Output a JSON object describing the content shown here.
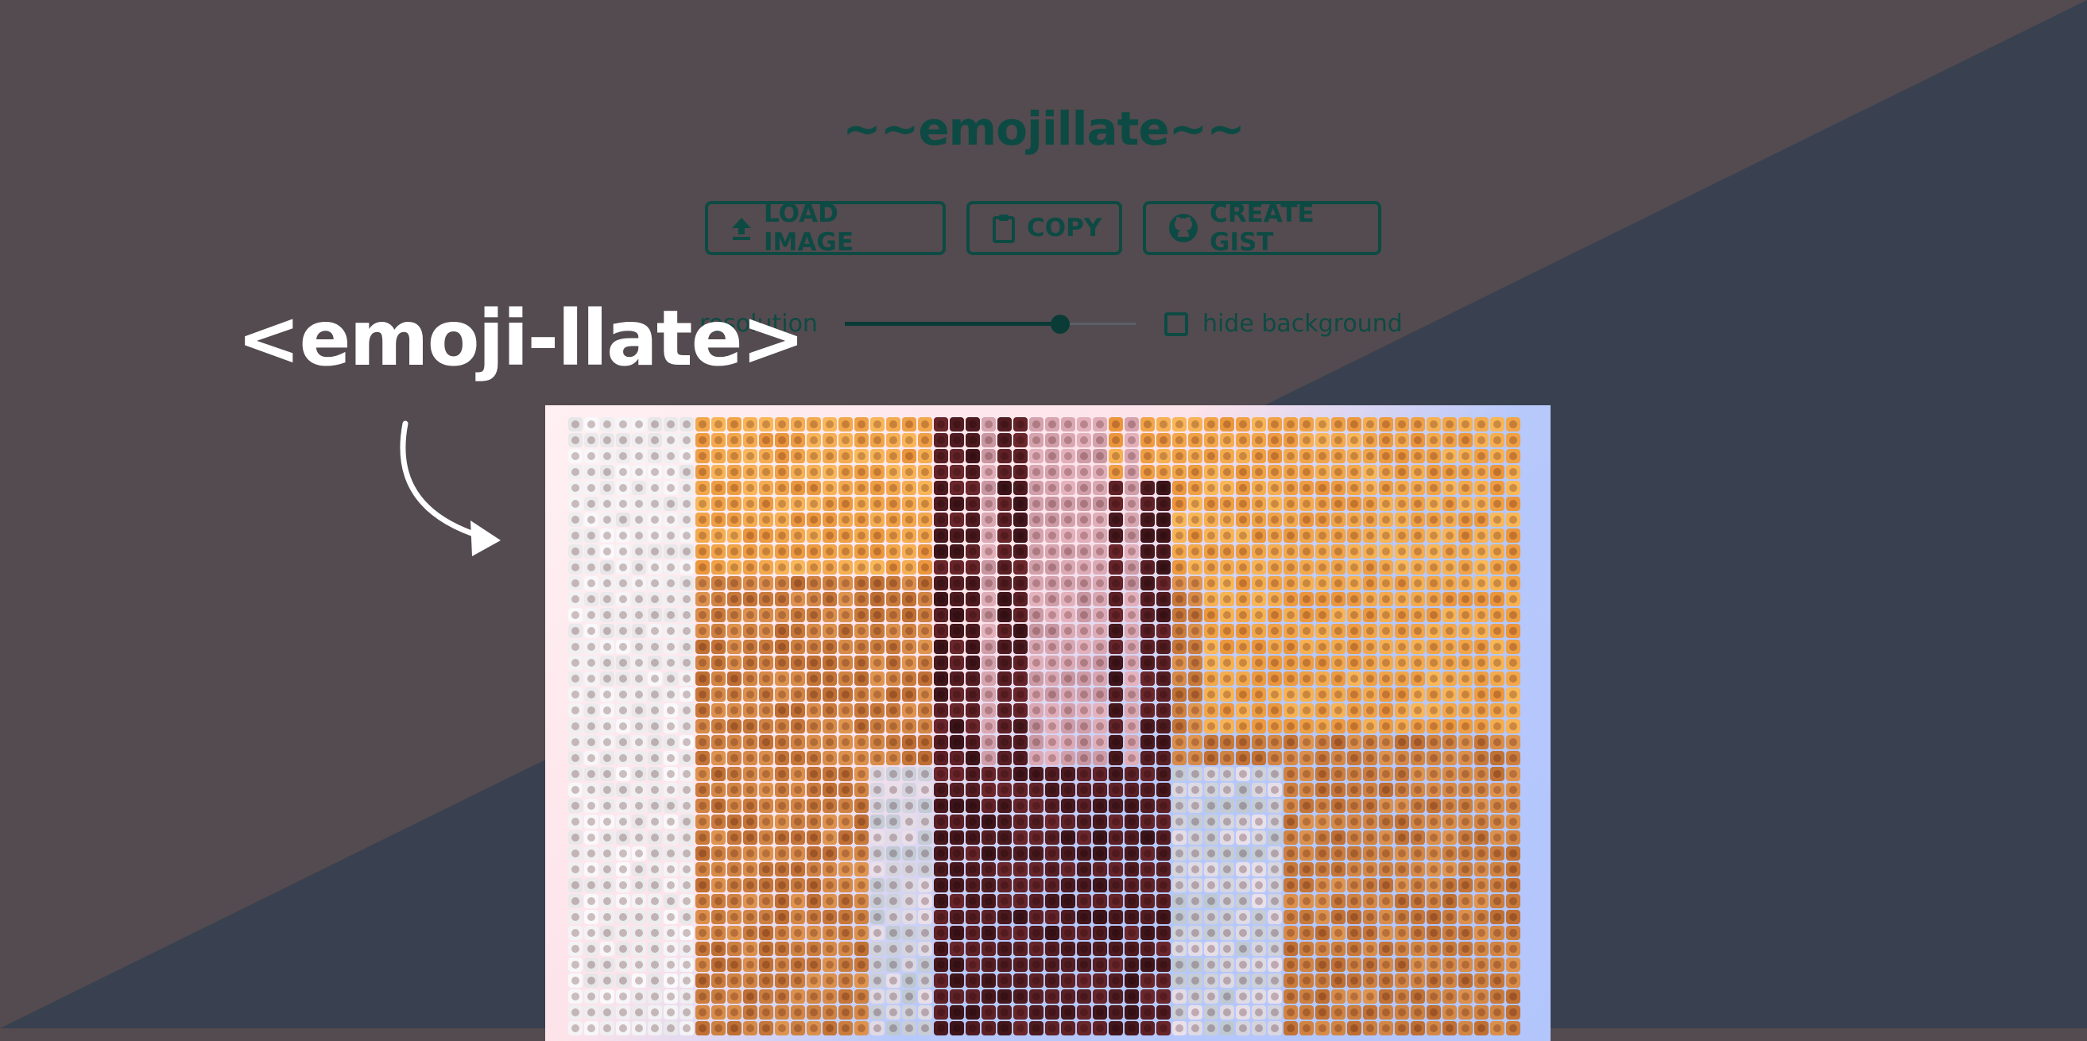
{
  "app": {
    "title": "~~emojillate~~",
    "tag_label": "<emoji-llate>"
  },
  "toolbar": {
    "load_label": "LOAD IMAGE",
    "copy_label": "COPY",
    "gist_label": "CREATE GIST",
    "load_icon": "upload-icon",
    "copy_icon": "clipboard-icon",
    "gist_icon": "github-icon"
  },
  "controls": {
    "resolution_label": "resolution",
    "resolution_value_fraction": 0.74,
    "hide_background_label": "hide background",
    "hide_background_checked": false
  },
  "colors": {
    "background_dark": "#534b4f",
    "background_slate": "#394150",
    "accent": "#0e4a44",
    "tag_text": "#ffffff"
  },
  "mosaic": {
    "description_icon": "emoji-mosaic-image"
  }
}
